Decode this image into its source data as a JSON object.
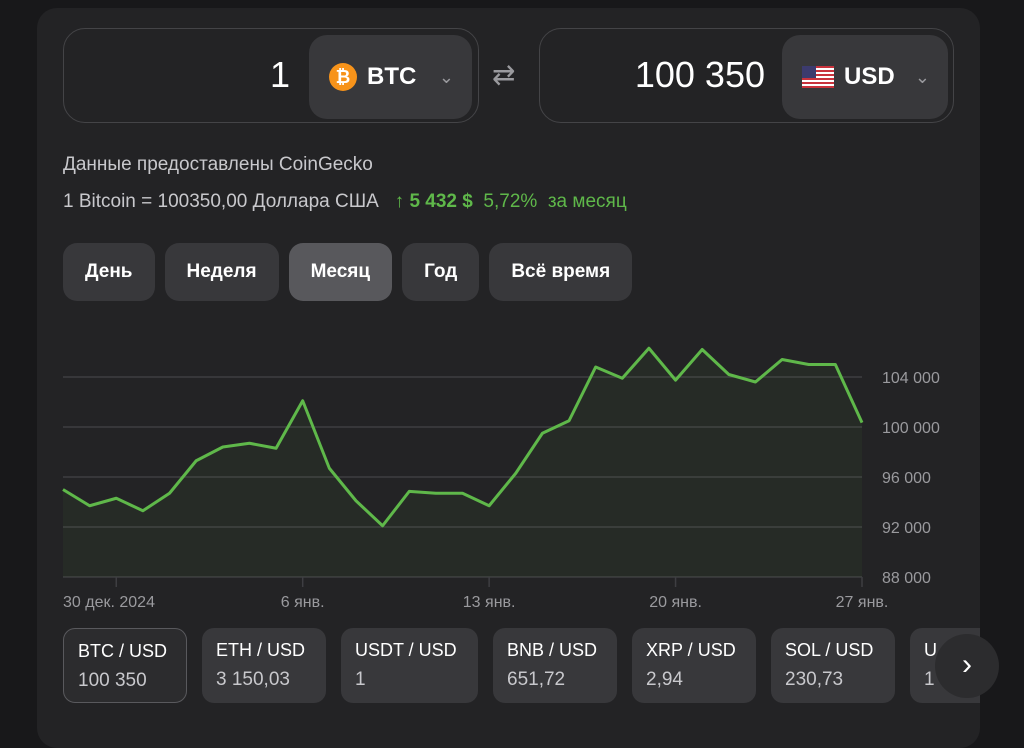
{
  "converter": {
    "from": {
      "amount": "1",
      "currency": "BTC",
      "icon": "bitcoin-icon",
      "icon_color": "#f7931a"
    },
    "to": {
      "amount": "100 350",
      "currency": "USD",
      "icon": "us-flag-icon"
    },
    "swap_icon": "swap-arrows-icon"
  },
  "source_text": "Данные предоставлены CoinGecko",
  "rate": {
    "text": "1 Bitcoin = 100350,00 Доллара США",
    "change_arrow": "↑",
    "change_abs": "5 432 $",
    "change_pct": "5,72%",
    "period": "за месяц",
    "color": "#5fb84a"
  },
  "periods": [
    {
      "label": "День",
      "active": false
    },
    {
      "label": "Неделя",
      "active": false
    },
    {
      "label": "Месяц",
      "active": true
    },
    {
      "label": "Год",
      "active": false
    },
    {
      "label": "Всё время",
      "active": false
    }
  ],
  "chart_data": {
    "type": "area",
    "x": [
      "2024-12-28",
      "2024-12-29",
      "2024-12-30",
      "2024-12-31",
      "2025-01-01",
      "2025-01-02",
      "2025-01-03",
      "2025-01-04",
      "2025-01-05",
      "2025-01-06",
      "2025-01-07",
      "2025-01-08",
      "2025-01-09",
      "2025-01-10",
      "2025-01-11",
      "2025-01-12",
      "2025-01-13",
      "2025-01-14",
      "2025-01-15",
      "2025-01-16",
      "2025-01-17",
      "2025-01-18",
      "2025-01-19",
      "2025-01-20",
      "2025-01-21",
      "2025-01-22",
      "2025-01-23",
      "2025-01-24",
      "2025-01-25",
      "2025-01-26",
      "2025-01-27"
    ],
    "values": [
      95000,
      93700,
      94300,
      93300,
      94700,
      97300,
      98400,
      98700,
      98300,
      102100,
      96700,
      94100,
      92100,
      94850,
      94700,
      94700,
      93700,
      96300,
      99500,
      100500,
      104800,
      103900,
      106300,
      103750,
      106200,
      104200,
      103600,
      105400,
      105000,
      105000,
      100350
    ],
    "ylim": [
      88000,
      107200
    ],
    "yticks": [
      "88 000",
      "92 000",
      "96 000",
      "100 000",
      "104 000"
    ],
    "ytick_values": [
      88000,
      92000,
      96000,
      100000,
      104000
    ],
    "xtick_labels": [
      "30 дек. 2024",
      "6 янв.",
      "13 янв.",
      "20 янв.",
      "27 янв."
    ],
    "xtick_dates": [
      "2024-12-30",
      "2025-01-06",
      "2025-01-13",
      "2025-01-20",
      "2025-01-27"
    ],
    "line_color": "#5fb84a",
    "grid": true
  },
  "pairs": [
    {
      "pair": "BTC / USD",
      "price": "100 350",
      "active": true
    },
    {
      "pair": "ETH / USD",
      "price": "3 150,03"
    },
    {
      "pair": "USDT / USD",
      "price": "1"
    },
    {
      "pair": "BNB / USD",
      "price": "651,72"
    },
    {
      "pair": "XRP / USD",
      "price": "2,94"
    },
    {
      "pair": "SOL / USD",
      "price": "230,73"
    },
    {
      "pair": "U",
      "price": "1"
    }
  ],
  "next_icon": "chevron-right-icon"
}
